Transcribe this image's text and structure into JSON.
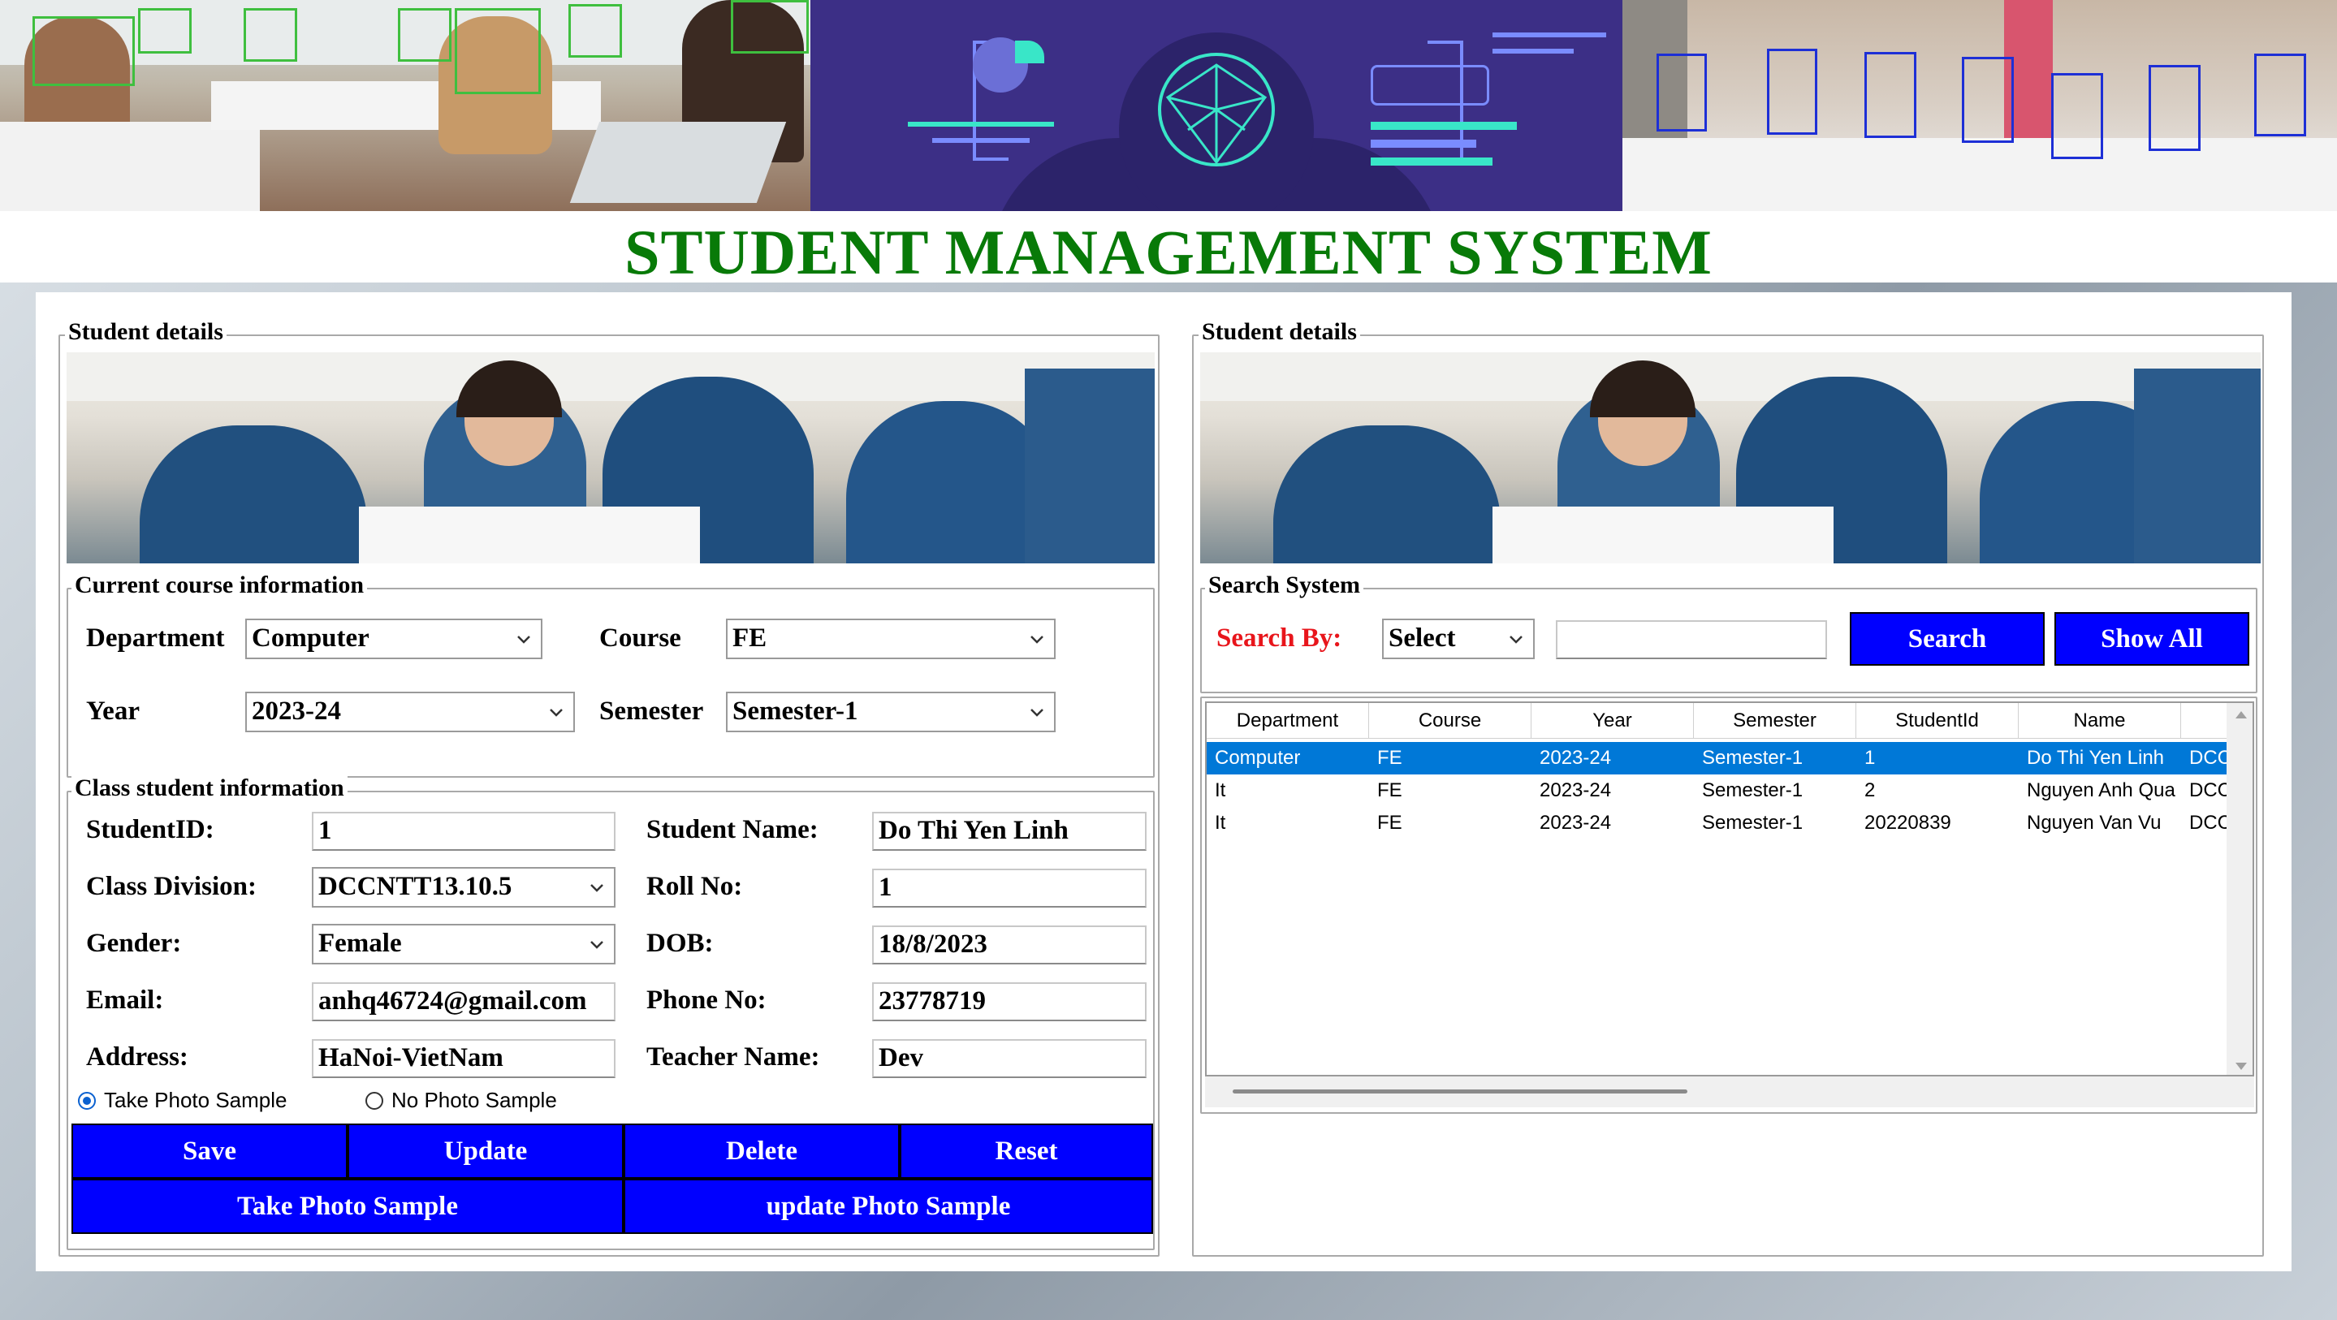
{
  "app": {
    "title": "STUDENT MANAGEMENT SYSTEM"
  },
  "left_panel": {
    "legend": "Student details",
    "course_group": {
      "legend": "Current course information",
      "department_label": "Department",
      "department_value": "Computer",
      "course_label": "Course",
      "course_value": "FE",
      "year_label": "Year",
      "year_value": "2023-24",
      "semester_label": "Semester",
      "semester_value": "Semester-1"
    },
    "class_group": {
      "legend": "Class student information",
      "student_id_label": "StudentID:",
      "student_id_value": "1",
      "student_name_label": "Student Name:",
      "student_name_value": "Do Thi Yen Linh",
      "class_division_label": "Class Division:",
      "class_division_value": "DCCNTT13.10.5",
      "roll_no_label": "Roll No:",
      "roll_no_value": "1",
      "gender_label": "Gender:",
      "gender_value": "Female",
      "dob_label": "DOB:",
      "dob_value": "18/8/2023",
      "email_label": "Email:",
      "email_value": "anhq46724@gmail.com",
      "phone_label": "Phone No:",
      "phone_value": "23778719",
      "address_label": "Address:",
      "address_value": "HaNoi-VietNam",
      "teacher_label": "Teacher Name:",
      "teacher_value": "Dev",
      "radio_take": "Take Photo Sample",
      "radio_no": "No Photo Sample",
      "radio_selected": "take"
    },
    "buttons": {
      "save": "Save",
      "update": "Update",
      "delete": "Delete",
      "reset": "Reset",
      "take_photo": "Take Photo Sample",
      "update_photo": "update Photo Sample"
    }
  },
  "right_panel": {
    "legend": "Student details",
    "search_group": {
      "legend": "Search System",
      "search_by_label": "Search By:",
      "search_by_value": "Select",
      "search_input_value": "",
      "search_button": "Search",
      "show_all_button": "Show All"
    },
    "table": {
      "columns": [
        "Department",
        "Course",
        "Year",
        "Semester",
        "StudentId",
        "Name",
        ""
      ],
      "rows": [
        [
          "Computer",
          "FE",
          "2023-24",
          "Semester-1",
          "1",
          "Do Thi Yen Linh",
          "DCC"
        ],
        [
          "It",
          "FE",
          "2023-24",
          "Semester-1",
          "2",
          "Nguyen Anh Qua",
          "DCC"
        ],
        [
          "It",
          "FE",
          "2023-24",
          "Semester-1",
          "20220839",
          "Nguyen Van Vu",
          "DCC"
        ]
      ],
      "selected_row": 0
    }
  },
  "colors": {
    "title_green": "#087a08",
    "button_blue": "#0000ff",
    "search_label_red": "#e8151b",
    "selection_blue": "#0078d7"
  },
  "icons": {
    "combo_arrow": "chevron-down-icon",
    "scroll_up": "scroll-up-arrow-icon",
    "scroll_down": "scroll-down-arrow-icon"
  }
}
